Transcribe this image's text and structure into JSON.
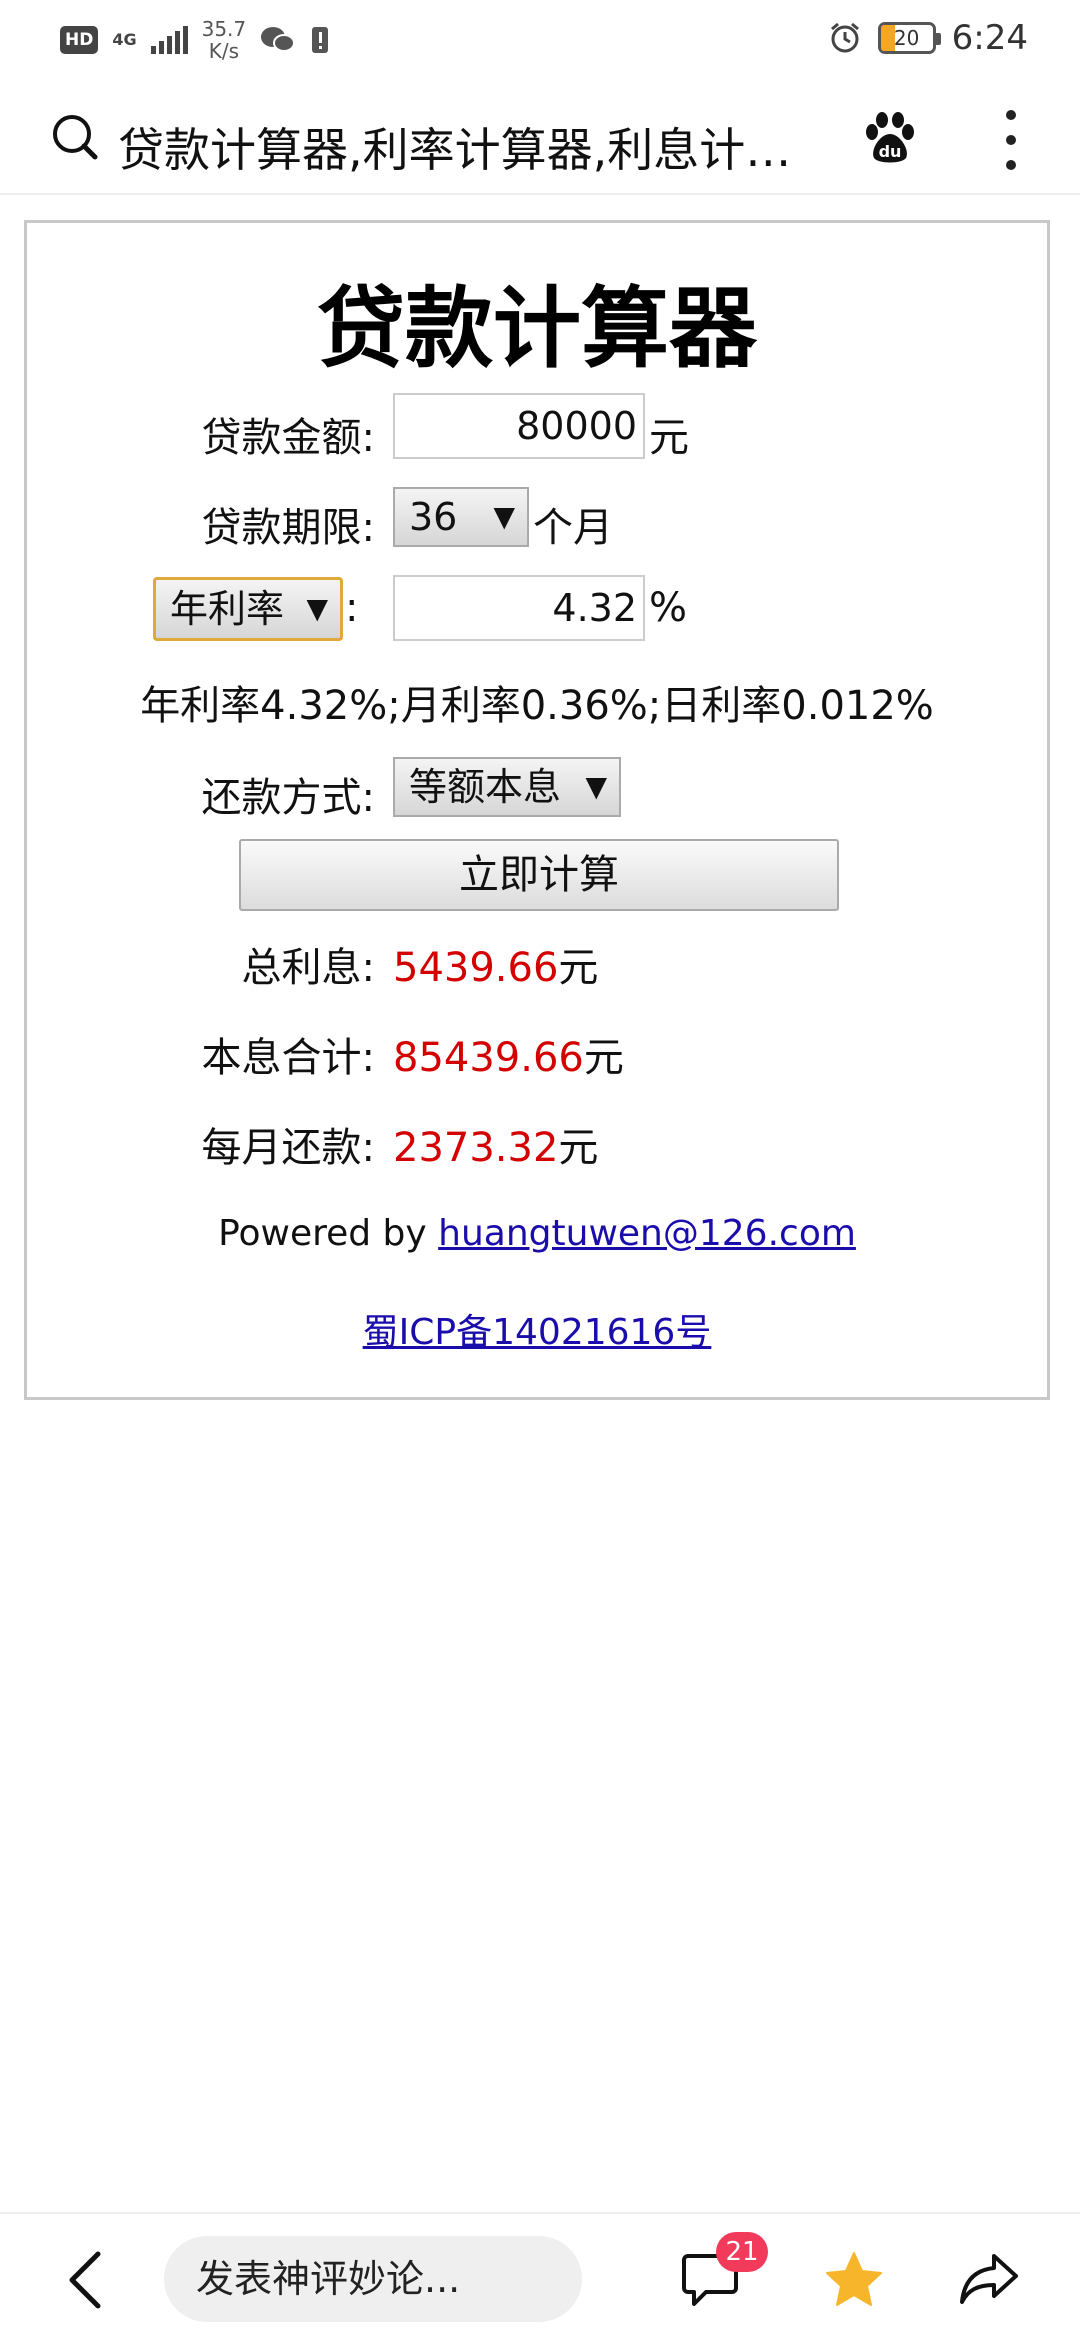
{
  "status_bar": {
    "hd": "HD",
    "network": "4G",
    "speed_value": "35.7",
    "speed_unit": "K/s",
    "battery": "20",
    "time": "6:24",
    "icons": [
      "signal-icon",
      "wechat-icon",
      "notification-icon",
      "alarm-icon",
      "battery-icon"
    ]
  },
  "header": {
    "title": "贷款计算器,利率计算器,利息计算器",
    "icons": [
      "search-icon",
      "baidu-icon",
      "more-icon"
    ]
  },
  "calculator": {
    "title": "贷款计算器",
    "amount": {
      "label": "贷款金额:",
      "value": "80000",
      "unit": "元"
    },
    "term": {
      "label": "贷款期限:",
      "value": "36",
      "unit": "个月"
    },
    "rate": {
      "type": "年利率",
      "colon": ":",
      "value": "4.32",
      "unit": "%"
    },
    "rate_summary": "年利率4.32%;月利率0.36%;日利率0.012%",
    "method": {
      "label": "还款方式:",
      "value": "等额本息"
    },
    "calculate_label": "立即计算",
    "results": {
      "total_interest": {
        "label": "总利息:",
        "value": "5439.66",
        "unit": "元"
      },
      "total_payment": {
        "label": "本息合计:",
        "value": "85439.66",
        "unit": "元"
      },
      "monthly_payment": {
        "label": "每月还款:",
        "value": "2373.32",
        "unit": "元"
      }
    },
    "powered_prefix": "Powered by",
    "powered_email": "huangtuwen@126.com",
    "icp": "蜀ICP备14021616号",
    "result_color": "#d40000",
    "link_color": "#1a0dab"
  },
  "bottom_bar": {
    "comment_placeholder": "发表神评妙论...",
    "comment_count": "21",
    "icons": [
      "back-icon",
      "comments-icon",
      "star-icon",
      "share-icon"
    ],
    "star_color": "#f7b52c",
    "badge_color": "#f23a5a"
  }
}
